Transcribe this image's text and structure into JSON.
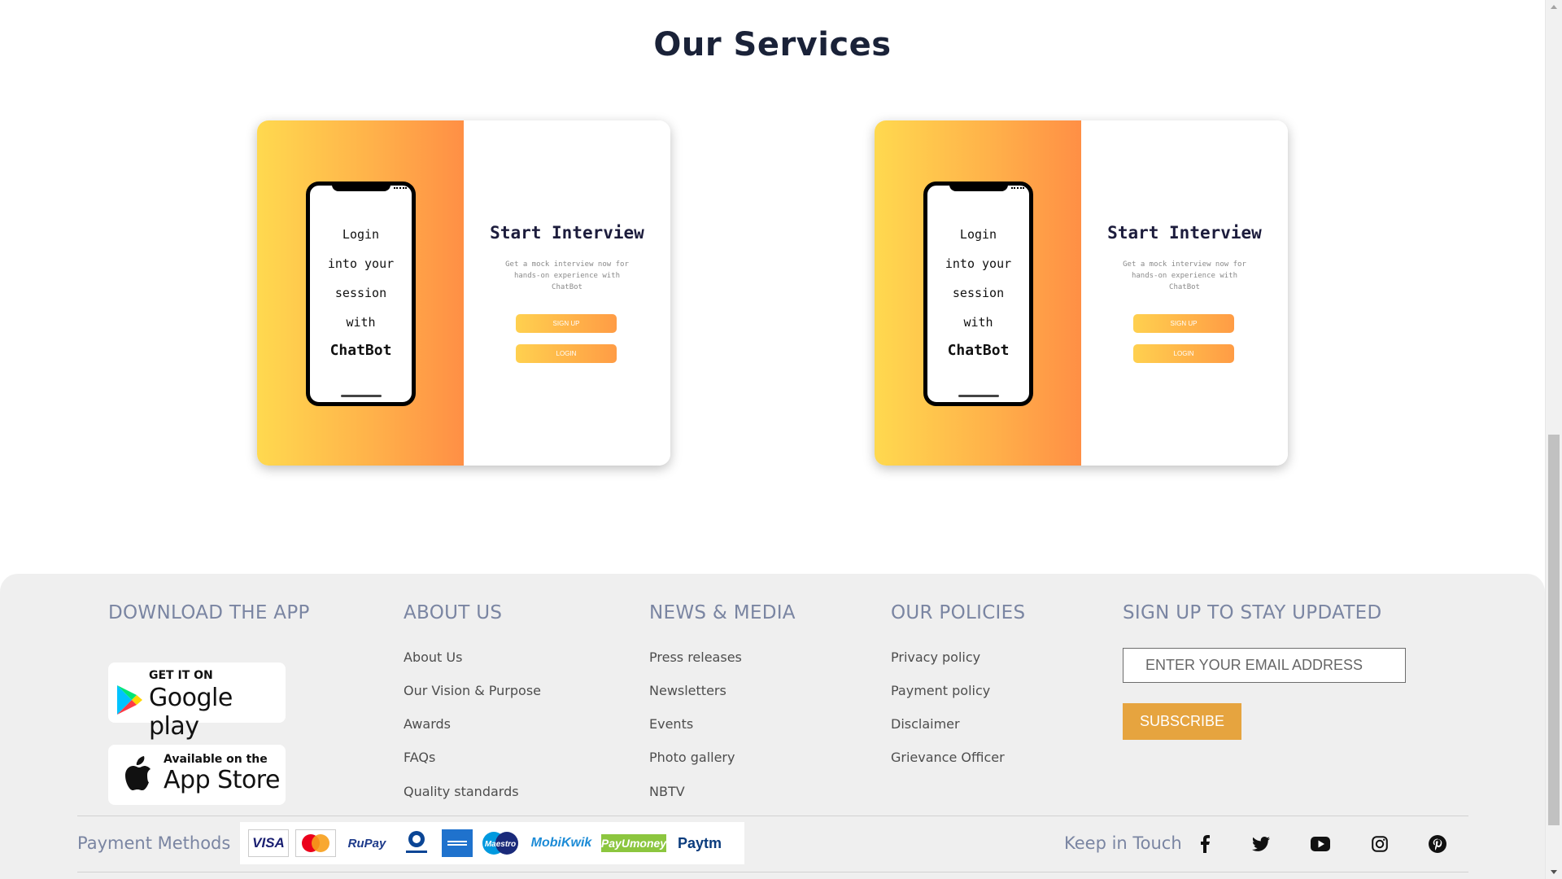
{
  "services": {
    "title": "Our Services",
    "cards": [
      {
        "phone_lines": [
          "Login",
          "into your",
          "session",
          "with"
        ],
        "phone_brand": "ChatBot",
        "heading": "Start Interview",
        "description": "Get a mock interview now for hands-on experience with ChatBot",
        "signup_label": "SIGN UP",
        "login_label": "LOGIN"
      },
      {
        "phone_lines": [
          "Login",
          "into your",
          "session",
          "with"
        ],
        "phone_brand": "ChatBot",
        "heading": "Start Interview",
        "description": "Get a mock interview now for hands-on experience with ChatBot",
        "signup_label": "SIGN UP",
        "login_label": "LOGIN"
      }
    ]
  },
  "footer": {
    "download": {
      "title": "DOWNLOAD THE APP",
      "google_small": "GET IT ON",
      "google_big": "Google play",
      "apple_small": "Available on the",
      "apple_big": "App Store"
    },
    "about": {
      "title": "ABOUT US",
      "links": [
        "About Us",
        "Our Vision & Purpose",
        "Awards",
        "FAQs",
        "Quality standards"
      ]
    },
    "news": {
      "title": "NEWS & MEDIA",
      "links": [
        "Press releases",
        "Newsletters",
        "Events",
        "Photo gallery",
        "NBTV"
      ]
    },
    "policies": {
      "title": "OUR POLICIES",
      "links": [
        "Privacy policy",
        "Payment policy",
        "Disclaimer",
        "Grievance Officer"
      ]
    },
    "signup": {
      "title": "SIGN UP TO STAY UPDATED",
      "email_placeholder": "ENTER YOUR EMAIL ADDRESS",
      "subscribe_label": "SUBSCRIBE"
    },
    "payment_label": "Payment Methods",
    "payment_methods": [
      "VISA",
      "MasterCard",
      "RuPay",
      "Diners Club International",
      "American Express",
      "Maestro",
      "MobiKwik",
      "PayUmoney",
      "Paytm"
    ],
    "keep_in_touch_label": "Keep in Touch",
    "social_icons": [
      "facebook-icon",
      "twitter-icon",
      "youtube-icon",
      "instagram-icon",
      "pinterest-icon"
    ]
  },
  "colors": {
    "accent_orange": "#e6a43f",
    "gradient_start": "#ffd94f",
    "gradient_end": "#ff8f45",
    "footer_heading": "#7a85a2"
  }
}
